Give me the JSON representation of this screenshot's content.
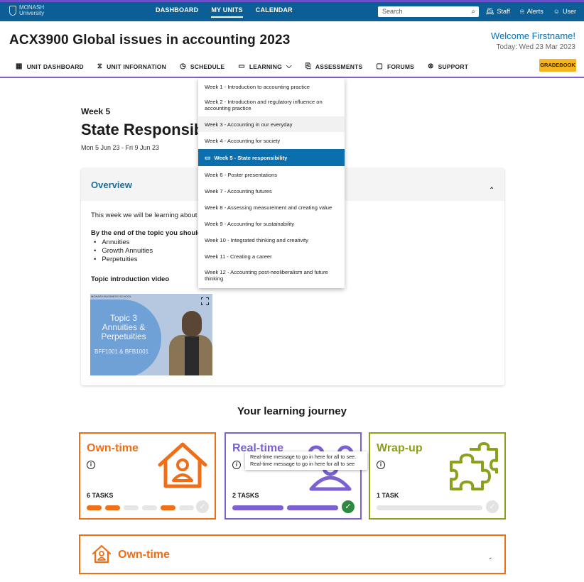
{
  "topbar": {
    "logo_line1": "MONASH",
    "logo_line2": "University",
    "nav": [
      "DASHBOARD",
      "MY UNITS",
      "CALENDAR"
    ],
    "nav_active": "MY UNITS",
    "search_placeholder": "Search",
    "right": [
      {
        "icon": "staff-card-icon",
        "label": "Staff"
      },
      {
        "icon": "bell-icon",
        "label": "Alerts"
      },
      {
        "icon": "user-icon",
        "label": "User"
      }
    ]
  },
  "header": {
    "unit_title": "ACX3900 Global issues in accounting 2023",
    "welcome": "Welcome Firstname!",
    "today": "Today: Wed 23 Mar 2023"
  },
  "unit_nav": {
    "items": [
      {
        "icon": "grid-icon",
        "label": "UNIT DASHBOARD"
      },
      {
        "icon": "hourglass-icon",
        "label": "UNIT INFORNATION"
      },
      {
        "icon": "clock-icon",
        "label": "SCHEDULE"
      },
      {
        "icon": "book-icon",
        "label": "LEARNING"
      },
      {
        "icon": "assessment-icon",
        "label": "ASSESSMENTS"
      },
      {
        "icon": "chat-icon",
        "label": "FORUMS"
      },
      {
        "icon": "lifebuoy-icon",
        "label": "SUPPORT"
      }
    ],
    "gradebook": "GRADEBOOK"
  },
  "week": {
    "label": "Week 5",
    "title": "State Responsibility",
    "dates": "Mon 5 Jun 23 - Fri 9 Jun 23"
  },
  "overview": {
    "heading": "Overview",
    "intro": "This week we will be learning about A",
    "end_of_topic": "By the end of the topic you should un",
    "bullets": [
      "Annuities",
      "Growth Annuities",
      "Perpetuities"
    ],
    "video_heading": "Topic introduction video",
    "video": {
      "corner_text": "MONASH BUSINESS SCHOOL",
      "title_line1": "Topic 3",
      "title_line2": "Annuities &",
      "title_line3": "Perpetuities",
      "codes": "BFF1001 & BFB1001"
    }
  },
  "dropdown": {
    "items": [
      "Week 1 - Introduction to accounting practice",
      "Week 2 - Introduction and regulatory influence on accounting practice",
      "Week 3 - Accounting in our everyday",
      "Week 4 - Accounting for society",
      "Week 5 - State responsibility",
      "Week 6 - Poster presentations",
      "Week 7 - Accounting futures",
      "Week 8 - Assessing measurement and creating value",
      "Week 9 - Accounting for sustainability",
      "Week 10 - Integrated thinking and creativity",
      "Week 11 - Creating a career",
      "Week 12 - Accounting post-neoliberalism and future thinking"
    ],
    "selected_index": 4
  },
  "journey": {
    "heading": "Your learning journey",
    "cards": [
      {
        "title": "Own-time",
        "tasks": "6 TASKS",
        "color": "#f06e16"
      },
      {
        "title": "Real-time",
        "tasks": "2 TASKS",
        "color": "#7b61d1"
      },
      {
        "title": "Wrap-up",
        "tasks": "1 TASK",
        "color": "#8aa11c"
      }
    ],
    "tooltip_line1": "Real-time message to go in here for all to see.",
    "tooltip_line2": "Real-time message to go in here for all to see"
  },
  "own_panel": {
    "title": "Own-time"
  }
}
